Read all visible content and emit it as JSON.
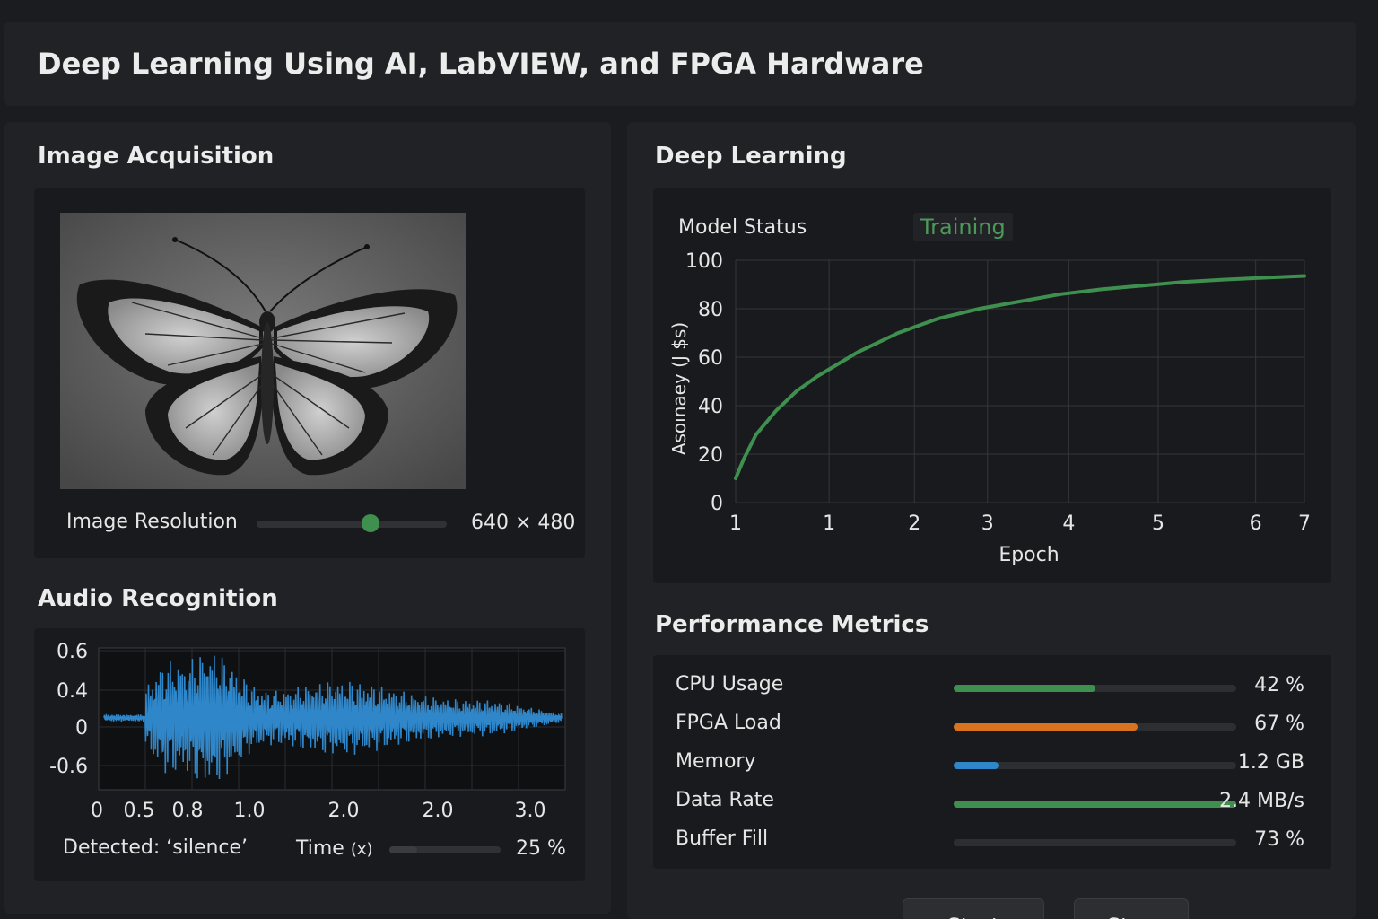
{
  "header": {
    "title": "Deep Learning Using AI, LabVIEW, and FPGA Hardware"
  },
  "image_acquisition": {
    "title": "Image Acquisition",
    "image_subject": "butterfly",
    "resolution_label": "Image Resolution",
    "resolution_value": "640 × 480",
    "slider_level": 0.6
  },
  "audio": {
    "title": "Audio Recognition",
    "y_ticks": [
      "0.6",
      "0.4",
      "0",
      "-0.6"
    ],
    "x_ticks": [
      "0",
      "0.5",
      "0.8",
      "1.0",
      "2.0",
      "2.0",
      "3.0"
    ],
    "detected_label": "Detected: ‘silence’",
    "time_label": "Time",
    "time_unit": "(x)",
    "time_value": "25 %",
    "time_level": 0.25,
    "waveform_color": "#2f86c9"
  },
  "deep_learning": {
    "title": "Deep Learning",
    "model_status_label": "Model Status",
    "model_status_value": "Training",
    "status_color": "#4c9a5a"
  },
  "chart_data": {
    "type": "line",
    "title": "",
    "xlabel": "Epoch",
    "ylabel": "Asoınaey (J $s)",
    "x_tick_labels": [
      "1",
      "1",
      "2",
      "3",
      "4",
      "5",
      "6",
      "7"
    ],
    "y_ticks": [
      0,
      20,
      40,
      60,
      80,
      100
    ],
    "ylim": [
      0,
      100
    ],
    "grid": true,
    "series": [
      {
        "color": "#3f8f4f",
        "x": [
          0,
          0.1,
          0.25,
          0.5,
          0.75,
          1,
          1.5,
          2,
          2.5,
          3,
          3.5,
          4,
          4.5,
          5,
          5.5,
          6,
          6.5,
          7
        ],
        "values": [
          10,
          18,
          28,
          38,
          46,
          52,
          62,
          70,
          76,
          80,
          83,
          86,
          88,
          89.5,
          91,
          92,
          92.8,
          93.5
        ]
      }
    ]
  },
  "performance": {
    "title": "Performance Metrics",
    "metrics": [
      {
        "label": "CPU Usage",
        "value": "42 %",
        "level": 0.5,
        "color": "#3f8f4f"
      },
      {
        "label": "FPGA Load",
        "value": "67 %",
        "level": 0.65,
        "color": "#d9731f"
      },
      {
        "label": "Memory",
        "value": "1.2 GB",
        "level": 0.16,
        "color": "#2f86c9"
      },
      {
        "label": "Data Rate",
        "value": "2.4 MB/s",
        "level": 1.0,
        "color": "#3f8f4f"
      },
      {
        "label": "Buffer Fill",
        "value": "73 %",
        "level": 0,
        "color": "#3f8f4f"
      }
    ]
  },
  "controls": {
    "start_label": "Start",
    "stop_label": "Stop"
  }
}
